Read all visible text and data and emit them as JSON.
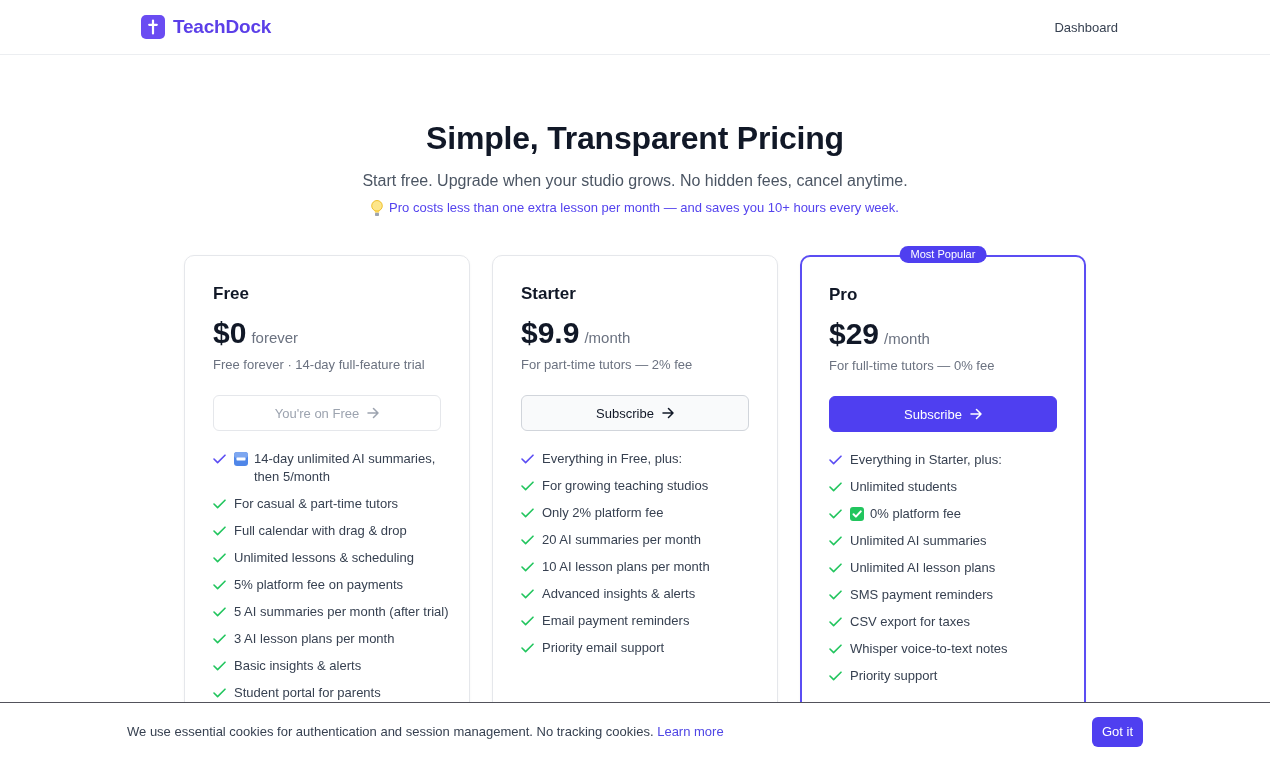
{
  "header": {
    "brand": "TeachDock",
    "nav": [
      {
        "label": "Dashboard"
      }
    ]
  },
  "hero": {
    "title": "Simple, Transparent Pricing",
    "subtitle": "Start free. Upgrade when your studio grows. No hidden fees, cancel anytime.",
    "tip": "Pro costs less than one extra lesson per month — and saves you 10+ hours every week."
  },
  "plans": [
    {
      "name": "Free",
      "price": "$0",
      "period": "forever",
      "note": "Free forever · 14-day full-feature trial",
      "featured": false,
      "button": {
        "label": "You're on Free",
        "current": true
      },
      "features": [
        {
          "text": "14-day unlimited AI summaries, then 5/month",
          "kind": "tagged"
        },
        {
          "text": "For casual & part-time tutors",
          "kind": "plain"
        },
        {
          "text": "Full calendar with drag & drop",
          "kind": "plain"
        },
        {
          "text": "Unlimited lessons & scheduling",
          "kind": "plain"
        },
        {
          "text": "5% platform fee on payments",
          "kind": "plain"
        },
        {
          "text": "5 AI summaries per month (after trial)",
          "kind": "plain"
        },
        {
          "text": "3 AI lesson plans per month",
          "kind": "plain"
        },
        {
          "text": "Basic insights & alerts",
          "kind": "plain"
        },
        {
          "text": "Student portal for parents",
          "kind": "plain"
        }
      ]
    },
    {
      "name": "Starter",
      "price": "$9.9",
      "period": "/month",
      "note": "For part-time tutors — 2% fee",
      "featured": false,
      "button": {
        "label": "Subscribe",
        "current": false
      },
      "features": [
        {
          "text": "Everything in Free, plus:",
          "kind": "lead"
        },
        {
          "text": "For growing teaching studios",
          "kind": "plain"
        },
        {
          "text": "Only 2% platform fee",
          "kind": "plain"
        },
        {
          "text": "20 AI summaries per month",
          "kind": "plain"
        },
        {
          "text": "10 AI lesson plans per month",
          "kind": "plain"
        },
        {
          "text": "Advanced insights & alerts",
          "kind": "plain"
        },
        {
          "text": "Email payment reminders",
          "kind": "plain"
        },
        {
          "text": "Priority email support",
          "kind": "plain"
        }
      ]
    },
    {
      "name": "Pro",
      "price": "$29",
      "period": "/month",
      "note": "For full-time tutors — 0% fee",
      "featured": true,
      "badge": "Most Popular",
      "button": {
        "label": "Subscribe",
        "current": false
      },
      "features": [
        {
          "text": "Everything in Starter, plus:",
          "kind": "lead"
        },
        {
          "text": "Unlimited students",
          "kind": "plain"
        },
        {
          "text": "0% platform fee",
          "kind": "ticked"
        },
        {
          "text": "Unlimited AI summaries",
          "kind": "plain"
        },
        {
          "text": "Unlimited AI lesson plans",
          "kind": "plain"
        },
        {
          "text": "SMS payment reminders",
          "kind": "plain"
        },
        {
          "text": "CSV export for taxes",
          "kind": "plain"
        },
        {
          "text": "Whisper voice-to-text notes",
          "kind": "plain"
        },
        {
          "text": "Priority support",
          "kind": "plain"
        }
      ]
    }
  ],
  "cookie_banner": {
    "text": "We use essential cookies for authentication and session management. No tracking cookies.",
    "link": "Learn more",
    "button": "Got it"
  }
}
